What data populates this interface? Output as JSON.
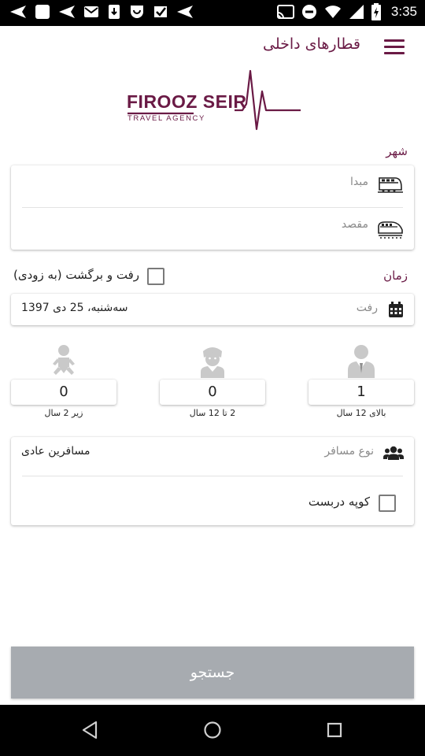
{
  "status_bar": {
    "time": "3:35"
  },
  "app_bar": {
    "title": "قطارهای داخلی"
  },
  "logo": {
    "name": "FIROOZ SEIR",
    "tagline": "TRAVEL AGENCY"
  },
  "city": {
    "label": "شهر",
    "origin_placeholder": "مبدا",
    "destination_placeholder": "مقصد"
  },
  "time_section": {
    "label": "زمان",
    "round_trip_label": "رفت و برگشت (به زودی)",
    "depart_placeholder": "رفت",
    "depart_date": "سه‌شنبه، 25 دی 1397"
  },
  "passengers": {
    "adult": {
      "count": "1",
      "caption": "بالای 12 سال"
    },
    "child": {
      "count": "0",
      "caption": "2 تا 12 سال"
    },
    "infant": {
      "count": "0",
      "caption": "زیر 2 سال"
    }
  },
  "passenger_type": {
    "placeholder": "نوع مسافر",
    "value": "مسافرین عادی",
    "private_coupe_label": "کوپه دربست"
  },
  "search_button": {
    "label": "جستجو"
  },
  "colors": {
    "brand": "#6a1a45",
    "button_disabled": "#a7abb0"
  }
}
